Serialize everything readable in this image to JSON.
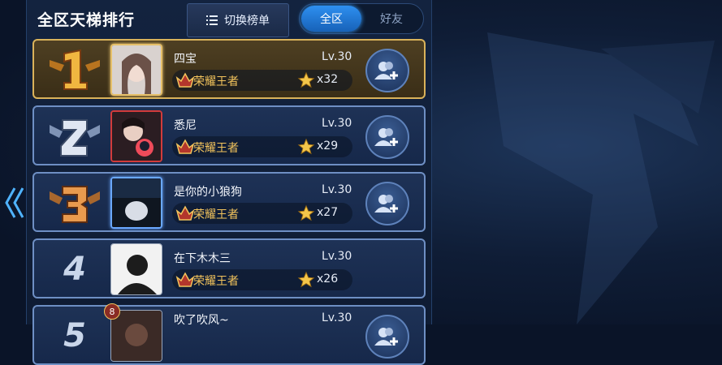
{
  "header": {
    "title": "全区天梯排行",
    "switch_label": "切换榜单",
    "tabs": [
      {
        "label": "全区",
        "active": true
      },
      {
        "label": "好友",
        "active": false
      }
    ]
  },
  "colors": {
    "accent": "#2e8ff0",
    "tier_text": "#f2c35c",
    "gold_border": "#d9b25a"
  },
  "rows": [
    {
      "rank": "1",
      "name": "四宝",
      "level": "Lv.30",
      "tier": "荣耀王者",
      "stars": "x32"
    },
    {
      "rank": "2",
      "name": "悉尼",
      "level": "Lv.30",
      "tier": "荣耀王者",
      "stars": "x29"
    },
    {
      "rank": "3",
      "name": "是你的小狼狗",
      "level": "Lv.30",
      "tier": "荣耀王者",
      "stars": "x27"
    },
    {
      "rank": "4",
      "name": "在下木木三",
      "level": "Lv.30",
      "tier": "荣耀王者",
      "stars": "x26"
    },
    {
      "rank": "5",
      "name": "吹了吹风~",
      "level": "Lv.30",
      "tier": "",
      "stars": "",
      "badge": "8"
    }
  ],
  "icons": {
    "back": "chevron-left-icon",
    "add_friend": "add-friend-icon",
    "star": "star-icon",
    "tier": "king-tier-icon"
  }
}
